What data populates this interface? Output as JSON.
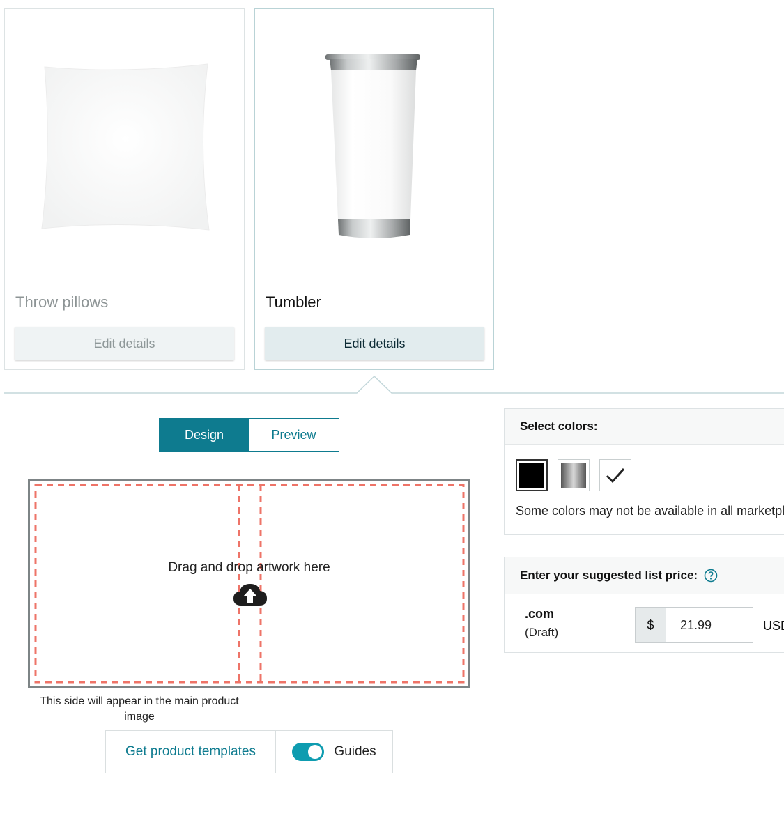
{
  "products": [
    {
      "name": "Throw pillows",
      "button_label": "Edit details"
    },
    {
      "name": "Tumbler",
      "button_label": "Edit details"
    }
  ],
  "mode_toggle": {
    "design_label": "Design",
    "preview_label": "Preview"
  },
  "canvas": {
    "drop_text": "Drag and drop artwork here",
    "caption": "This side will appear in the main product image"
  },
  "tools": {
    "templates_label": "Get product templates",
    "guides_label": "Guides",
    "guides_on": true
  },
  "colors_panel": {
    "title": "Select colors:",
    "note": "Some colors may not be available in all marketplaces.",
    "swatches": [
      {
        "name": "black",
        "color": "#000000",
        "selected": false
      },
      {
        "name": "silver",
        "color": "#8c8c8c",
        "selected": false
      },
      {
        "name": "white",
        "color": "#ffffff",
        "selected": true
      }
    ]
  },
  "price_panel": {
    "title": "Enter your suggested list price:",
    "marketplace": ".com",
    "status": "(Draft)",
    "currency_symbol": "$",
    "price": "21.99",
    "currency_code": "USD"
  },
  "colors": {
    "accent": "#0e7b8f",
    "guide_dash": "#ee7468",
    "canvas_border": "#7d8486"
  }
}
